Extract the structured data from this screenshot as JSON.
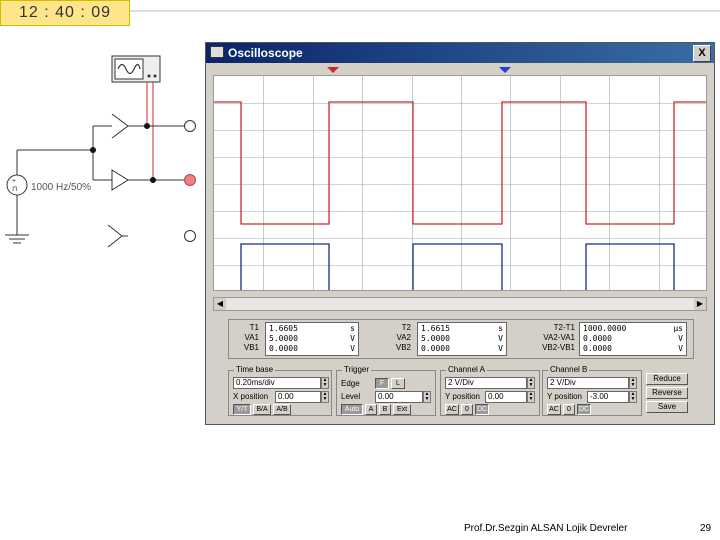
{
  "clock": {
    "time": "12 : 40 : 09"
  },
  "source": {
    "label": "1000 Hz/50%"
  },
  "window": {
    "title": "Oscilloscope",
    "close": "X"
  },
  "waveforms": {
    "channel_a_color": "#cc2a2a",
    "channel_b_color": "#1a2a8a",
    "grid_color": "#a6a6a6"
  },
  "readout": {
    "col1": {
      "labels": [
        "T1",
        "VA1",
        "VB1"
      ],
      "values": [
        [
          "1.6605",
          "s"
        ],
        [
          "5.0000",
          "V"
        ],
        [
          "0.0000",
          "V"
        ]
      ]
    },
    "col2": {
      "labels": [
        "T2",
        "VA2",
        "VB2"
      ],
      "values": [
        [
          "1.6615",
          "s"
        ],
        [
          "5.0000",
          "V"
        ],
        [
          "0.0000",
          "V"
        ]
      ]
    },
    "col3": {
      "labels": [
        "T2-T1",
        "VA2-VA1",
        "VB2-VB1"
      ],
      "values": [
        [
          "1000.0000",
          "µs"
        ],
        [
          "0.0000",
          "V"
        ],
        [
          "0.0000",
          "V"
        ]
      ]
    }
  },
  "timebase": {
    "title": "Time base",
    "scale": "0.20ms/div",
    "xpos_label": "X position",
    "xpos_value": "0.00",
    "buttons": [
      "Y/T",
      "B/A",
      "A/B"
    ]
  },
  "trigger": {
    "title": "Trigger",
    "edge_label": "Edge",
    "level_label": "Level",
    "level_value": "0.00",
    "edge_buttons": [
      "F",
      "L"
    ],
    "mode_buttons": [
      "Auto",
      "A",
      "B",
      "Ext"
    ]
  },
  "channel_a": {
    "title": "Channel A",
    "scale": "2 V/Div",
    "ypos_label": "Y position",
    "ypos_value": "0.00",
    "buttons": [
      "AC",
      "0",
      "DC"
    ]
  },
  "channel_b": {
    "title": "Channel B",
    "scale": "2 V/Div",
    "ypos_label": "Y position",
    "ypos_value": "-3.00",
    "buttons": [
      "AC",
      "0",
      "DC"
    ]
  },
  "side_buttons": [
    "Reduce",
    "Reverse",
    "Save"
  ],
  "footer": {
    "text": "Prof.Dr.Sezgin ALSAN  Lojik Devreler",
    "page": "29"
  }
}
